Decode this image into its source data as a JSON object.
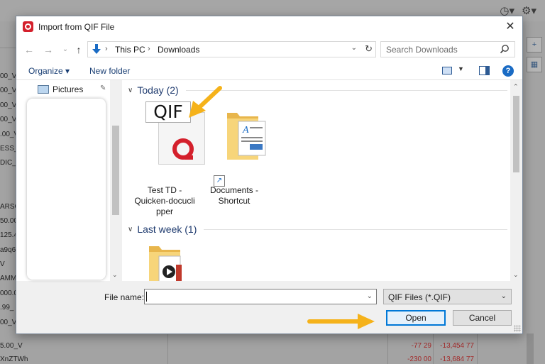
{
  "background": {
    "left_list": [
      "00_V",
      "00_V",
      "00_V",
      "00_V",
      ".00_V",
      "ESS_",
      "DIC_",
      "",
      "",
      "ARSC",
      "50.00",
      "125.4",
      "a9q6",
      "V",
      "AMM",
      "000.0",
      ".99_",
      "00_V"
    ],
    "rows": [
      {
        "c0": "5.00_V",
        "c1": "-77 29",
        "c2": "-13,454 77"
      },
      {
        "c0": "XnZTWh",
        "c1": "-230 00",
        "c2": "-13,684 77"
      }
    ]
  },
  "dialog": {
    "title": "Import from QIF File",
    "close_glyph": "✕",
    "nav": {
      "back_glyph": "←",
      "forward_glyph": "→",
      "recent_glyph": "⌄",
      "up_glyph": "↑"
    },
    "breadcrumbs": [
      "This PC",
      "Downloads"
    ],
    "crumb_sep": "›",
    "dropdown_glyph": "⌄",
    "refresh_glyph": "↻",
    "search": {
      "placeholder": "Search Downloads"
    },
    "toolbar": {
      "organize": "Organize ▾",
      "new_folder": "New folder",
      "view_dd": "▼",
      "help": "?"
    },
    "nav_pane": {
      "pinned_item": "Pictures",
      "pin_glyph": "📌",
      "scroll_down": "⌄"
    },
    "groups": [
      {
        "label": "Today (2)",
        "chevron": "∨"
      },
      {
        "label": "Last week (1)",
        "chevron": "∨"
      }
    ],
    "files": [
      {
        "name": "Test TD - Quicken-doculi pper",
        "lines": [
          "Test TD -",
          "Quicken-docucli",
          "pper"
        ],
        "badge": "QIF"
      },
      {
        "name": "Documents - Shortcut",
        "lines": [
          "Documents -",
          "Shortcut"
        ]
      }
    ],
    "file_pane_scroll": {
      "up": "⌃",
      "down": "⌄"
    },
    "filename": {
      "label": "File name:",
      "value": ""
    },
    "filetype": {
      "selected": "QIF Files (*.QIF)"
    },
    "buttons": {
      "open": "Open",
      "cancel": "Cancel"
    }
  },
  "colors": {
    "accent": "#0078d7",
    "annotation": "#f5b21a",
    "quicken_red": "#d4202c"
  },
  "icons": {
    "top_right": [
      "clock-icon",
      "gear-icon"
    ]
  }
}
